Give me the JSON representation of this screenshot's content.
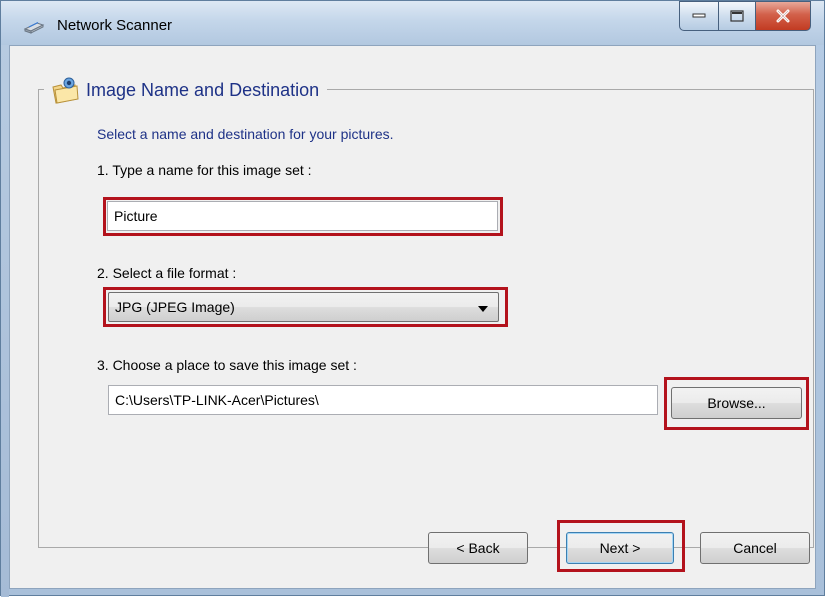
{
  "window": {
    "title": "Network Scanner",
    "icons": {
      "app": "scanner-icon",
      "minimize": "minimize-icon",
      "maximize": "maximize-icon",
      "close": "close-icon"
    }
  },
  "group": {
    "title": "Image Name and Destination",
    "icon": "folder-camera-icon"
  },
  "description": "Select a name and destination for your pictures.",
  "step1": {
    "label": "1. Type a name for this image set :",
    "value": "Picture"
  },
  "step2": {
    "label": "2. Select a file format :",
    "selected": "JPG (JPEG Image)"
  },
  "step3": {
    "label": "3. Choose a place to save this image set :",
    "value": "C:\\Users\\TP-LINK-Acer\\Pictures\\",
    "browse_label": "Browse..."
  },
  "buttons": {
    "back": "< Back",
    "next": "Next >",
    "cancel": "Cancel"
  },
  "colors": {
    "highlight": "#b3121c",
    "heading": "#1e3287"
  }
}
